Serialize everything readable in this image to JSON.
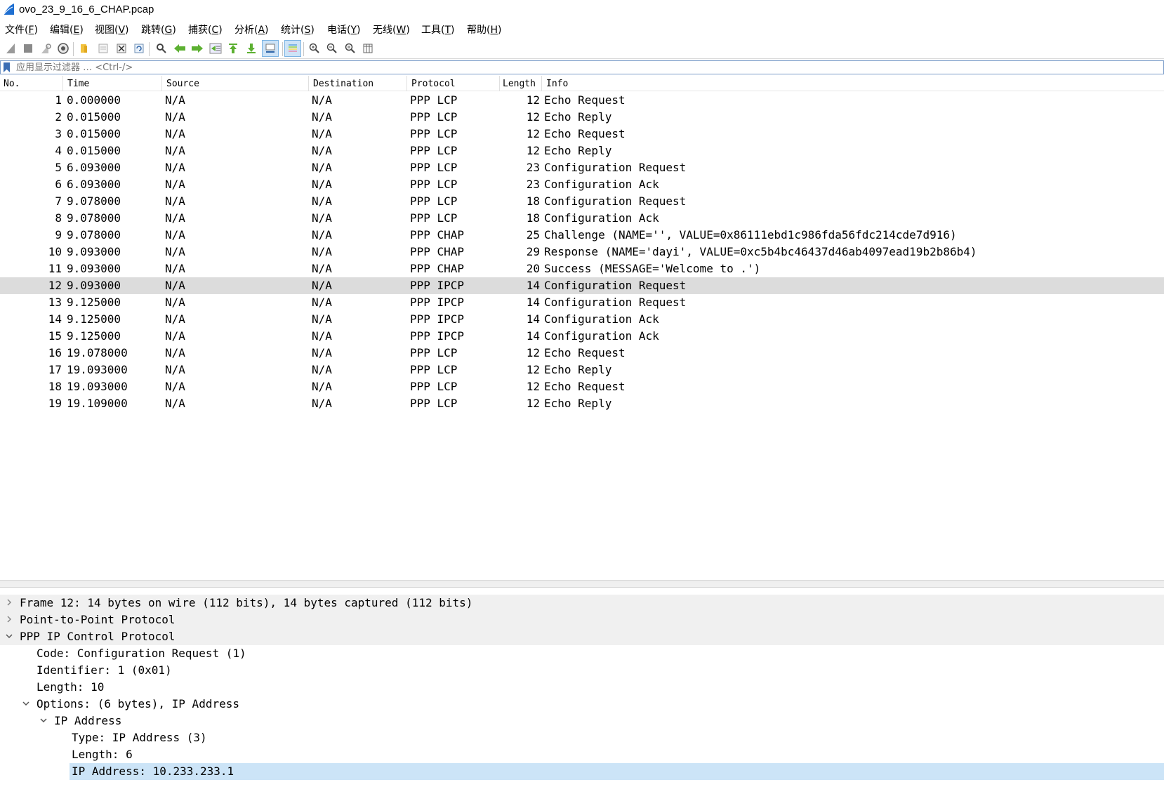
{
  "window": {
    "title": "ovo_23_9_16_6_CHAP.pcap"
  },
  "menu": [
    {
      "label": "文件(",
      "key": "F",
      "tail": ")"
    },
    {
      "label": "编辑(",
      "key": "E",
      "tail": ")"
    },
    {
      "label": "视图(",
      "key": "V",
      "tail": ")"
    },
    {
      "label": "跳转(",
      "key": "G",
      "tail": ")"
    },
    {
      "label": "捕获(",
      "key": "C",
      "tail": ")"
    },
    {
      "label": "分析(",
      "key": "A",
      "tail": ")"
    },
    {
      "label": "统计(",
      "key": "S",
      "tail": ")"
    },
    {
      "label": "电话(",
      "key": "Y",
      "tail": ")"
    },
    {
      "label": "无线(",
      "key": "W",
      "tail": ")"
    },
    {
      "label": "工具(",
      "key": "T",
      "tail": ")"
    },
    {
      "label": "帮助(",
      "key": "H",
      "tail": ")"
    }
  ],
  "filter": {
    "placeholder": "应用显示过滤器 … <Ctrl-/>"
  },
  "columns": [
    "No.",
    "Time",
    "Source",
    "Destination",
    "Protocol",
    "Length",
    "Info"
  ],
  "packets": [
    {
      "no": "1",
      "time": "0.000000",
      "src": "N/A",
      "dst": "N/A",
      "proto": "PPP LCP",
      "len": "12",
      "info": "Echo Request"
    },
    {
      "no": "2",
      "time": "0.015000",
      "src": "N/A",
      "dst": "N/A",
      "proto": "PPP LCP",
      "len": "12",
      "info": "Echo Reply"
    },
    {
      "no": "3",
      "time": "0.015000",
      "src": "N/A",
      "dst": "N/A",
      "proto": "PPP LCP",
      "len": "12",
      "info": "Echo Request"
    },
    {
      "no": "4",
      "time": "0.015000",
      "src": "N/A",
      "dst": "N/A",
      "proto": "PPP LCP",
      "len": "12",
      "info": "Echo Reply"
    },
    {
      "no": "5",
      "time": "6.093000",
      "src": "N/A",
      "dst": "N/A",
      "proto": "PPP LCP",
      "len": "23",
      "info": "Configuration Request"
    },
    {
      "no": "6",
      "time": "6.093000",
      "src": "N/A",
      "dst": "N/A",
      "proto": "PPP LCP",
      "len": "23",
      "info": "Configuration Ack"
    },
    {
      "no": "7",
      "time": "9.078000",
      "src": "N/A",
      "dst": "N/A",
      "proto": "PPP LCP",
      "len": "18",
      "info": "Configuration Request"
    },
    {
      "no": "8",
      "time": "9.078000",
      "src": "N/A",
      "dst": "N/A",
      "proto": "PPP LCP",
      "len": "18",
      "info": "Configuration Ack"
    },
    {
      "no": "9",
      "time": "9.078000",
      "src": "N/A",
      "dst": "N/A",
      "proto": "PPP CHAP",
      "len": "25",
      "info": "Challenge (NAME='', VALUE=0x86111ebd1c986fda56fdc214cde7d916)"
    },
    {
      "no": "10",
      "time": "9.093000",
      "src": "N/A",
      "dst": "N/A",
      "proto": "PPP CHAP",
      "len": "29",
      "info": "Response (NAME='dayi', VALUE=0xc5b4bc46437d46ab4097ead19b2b86b4)"
    },
    {
      "no": "11",
      "time": "9.093000",
      "src": "N/A",
      "dst": "N/A",
      "proto": "PPP CHAP",
      "len": "20",
      "info": "Success (MESSAGE='Welcome to .')"
    },
    {
      "no": "12",
      "time": "9.093000",
      "src": "N/A",
      "dst": "N/A",
      "proto": "PPP IPCP",
      "len": "14",
      "info": "Configuration Request"
    },
    {
      "no": "13",
      "time": "9.125000",
      "src": "N/A",
      "dst": "N/A",
      "proto": "PPP IPCP",
      "len": "14",
      "info": "Configuration Request"
    },
    {
      "no": "14",
      "time": "9.125000",
      "src": "N/A",
      "dst": "N/A",
      "proto": "PPP IPCP",
      "len": "14",
      "info": "Configuration Ack"
    },
    {
      "no": "15",
      "time": "9.125000",
      "src": "N/A",
      "dst": "N/A",
      "proto": "PPP IPCP",
      "len": "14",
      "info": "Configuration Ack"
    },
    {
      "no": "16",
      "time": "19.078000",
      "src": "N/A",
      "dst": "N/A",
      "proto": "PPP LCP",
      "len": "12",
      "info": "Echo Request"
    },
    {
      "no": "17",
      "time": "19.093000",
      "src": "N/A",
      "dst": "N/A",
      "proto": "PPP LCP",
      "len": "12",
      "info": "Echo Reply"
    },
    {
      "no": "18",
      "time": "19.093000",
      "src": "N/A",
      "dst": "N/A",
      "proto": "PPP LCP",
      "len": "12",
      "info": "Echo Request"
    },
    {
      "no": "19",
      "time": "19.109000",
      "src": "N/A",
      "dst": "N/A",
      "proto": "PPP LCP",
      "len": "12",
      "info": "Echo Reply"
    }
  ],
  "selected_packet": "12",
  "details": [
    {
      "text": "Frame 12: 14 bytes on wire (112 bits), 14 bytes captured (112 bits)",
      "level": 0,
      "expander": "collapsed",
      "top": true
    },
    {
      "text": "Point-to-Point Protocol",
      "level": 0,
      "expander": "collapsed",
      "top": true
    },
    {
      "text": "PPP IP Control Protocol",
      "level": 0,
      "expander": "expanded",
      "top": true
    },
    {
      "text": "Code: Configuration Request (1)",
      "level": 1,
      "expander": "none"
    },
    {
      "text": "Identifier: 1 (0x01)",
      "level": 1,
      "expander": "none"
    },
    {
      "text": "Length: 10",
      "level": 1,
      "expander": "none"
    },
    {
      "text": "Options: (6 bytes), IP Address",
      "level": 1,
      "expander": "expanded"
    },
    {
      "text": "IP Address",
      "level": 2,
      "expander": "expanded"
    },
    {
      "text": "Type: IP Address (3)",
      "level": 3,
      "expander": "none"
    },
    {
      "text": "Length: 6",
      "level": 3,
      "expander": "none"
    },
    {
      "text": "IP Address: 10.233.233.1",
      "level": 3,
      "expander": "none",
      "selected": true
    }
  ],
  "colors": {
    "selected_row": "#dcdcdc",
    "selected_detail": "#cce4f7",
    "accent": "#3b6db3"
  }
}
